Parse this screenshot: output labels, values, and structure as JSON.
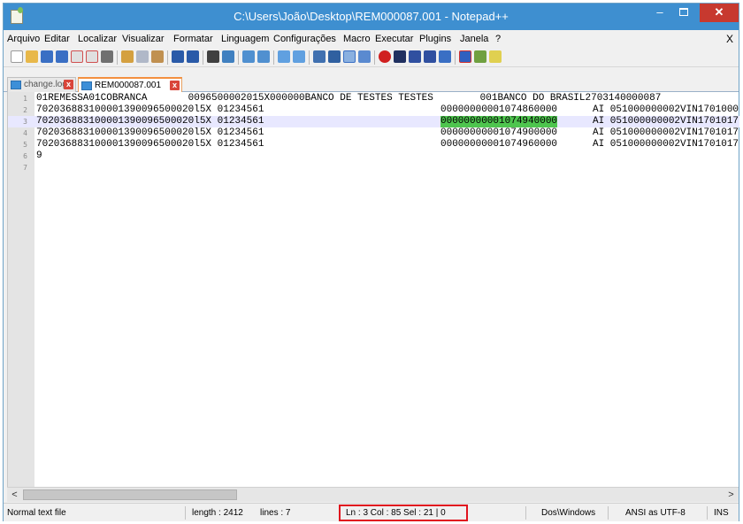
{
  "window": {
    "title": "C:\\Users\\João\\Desktop\\REM000087.001 - Notepad++",
    "minimize_label": "–",
    "close_label": "✕"
  },
  "menubar": {
    "items": [
      "Arquivo",
      "Editar",
      "Localizar",
      "Visualizar",
      "Formatar",
      "Linguagem",
      "Configurações",
      "Macro",
      "Executar",
      "Plugins",
      "Janela",
      "?"
    ],
    "close_label": "X"
  },
  "tabs": [
    {
      "label": "change.log",
      "active": false
    },
    {
      "label": "REM000087.001",
      "active": true
    }
  ],
  "editor": {
    "current_line": 3,
    "lines": [
      {
        "num": "1",
        "c1": "01REMESSA01COBRANCA       0096500002015X000000BANCO DE TESTES TESTES        001BANCO DO BRASIL2703140000087",
        "c2": "",
        "c3": ""
      },
      {
        "num": "2",
        "c1": "702036883100001390096500020l5X 01234561",
        "c2": "00000000001074860000",
        "c3": "AI 051000000002VIN1701000"
      },
      {
        "num": "3",
        "c1": "702036883100001390096500020l5X 01234561",
        "c2": "00000000001074940000",
        "c3": "AI 051000000002VIN1701017"
      },
      {
        "num": "4",
        "c1": "702036883100001390096500020l5X 01234561",
        "c2": "00000000001074900000",
        "c3": "AI 051000000002VIN1701017"
      },
      {
        "num": "5",
        "c1": "702036883100001390096500020l5X 01234561",
        "c2": "00000000001074960000",
        "c3": "AI 051000000002VIN1701017"
      },
      {
        "num": "6",
        "c1": "9",
        "c2": "",
        "c3": ""
      },
      {
        "num": "7",
        "c1": "",
        "c2": "",
        "c3": ""
      }
    ]
  },
  "scrollbar": {
    "left_arrow": "<",
    "right_arrow": ">"
  },
  "statusbar": {
    "file_type": "Normal text file",
    "length": "length : 2412",
    "lines": "lines : 7",
    "position": "Ln : 3   Col : 85   Sel : 21 | 0",
    "eol": "Dos\\Windows",
    "encoding": "ANSI as UTF-8",
    "mode": "INS"
  },
  "colors": {
    "titlebar": "#3e8fd0",
    "selection": "#4ec54e",
    "current_line": "#e8e8ff",
    "highlight_box": "#e0141e"
  }
}
